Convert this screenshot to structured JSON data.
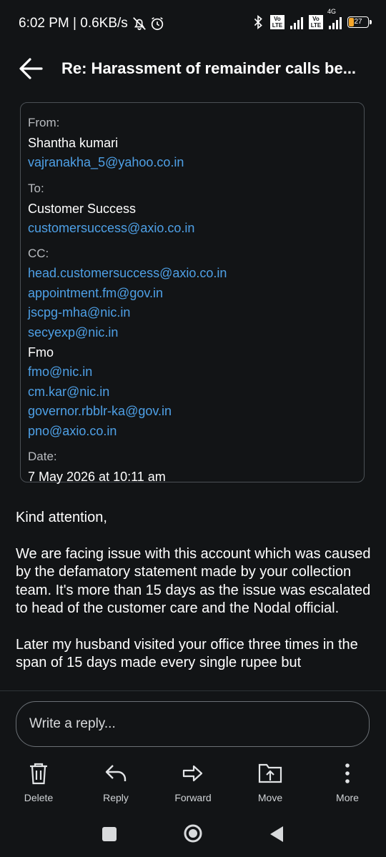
{
  "status": {
    "time": "6:02 PM | 0.6KB/s",
    "network": "4G",
    "volte1": "Vo LTE",
    "volte2": "Vo LTE",
    "battery": "27",
    "battery_level": 27,
    "battery_color": "#f4a62a"
  },
  "header": {
    "subject": "Re: Harassment of remainder calls be..."
  },
  "details": {
    "from_label": "From:",
    "from_name": "Shantha kumari",
    "from_email": "vajranakha_5@yahoo.co.in",
    "to_label": "To:",
    "to_name": "Customer Success",
    "to_email": "customersuccess@axio.co.in",
    "cc_label": "CC:",
    "cc1": "head.customersuccess@axio.co.in",
    "cc2": "appointment.fm@gov.in",
    "cc3": "jscpg-mha@nic.in",
    "cc4": "secyexp@nic.in",
    "cc_name": "Fmo",
    "cc5": "fmo@nic.in",
    "cc6": "cm.kar@nic.in",
    "cc7": "governor.rbblr-ka@gov.in",
    "cc8": "pno@axio.co.in",
    "date_label": "Date:",
    "date_value": "7 May 2026 at 10:11 am"
  },
  "body": {
    "p1": "Kind attention,",
    "p2": "We are facing issue with this account which was caused by the defamatory statement made by your collection team. It's more than 15 days as the issue was escalated to head of the customer care and the Nodal official.",
    "p3": "Later my husband visited your office three times in the span of 15 days made every single rupee but"
  },
  "reply": {
    "placeholder": "Write a reply..."
  },
  "actions": {
    "delete": "Delete",
    "reply": "Reply",
    "forward": "Forward",
    "move": "Move",
    "more": "More"
  },
  "colors": {
    "background": "#121416",
    "link": "#4ea0e6",
    "border": "#4b5055"
  }
}
